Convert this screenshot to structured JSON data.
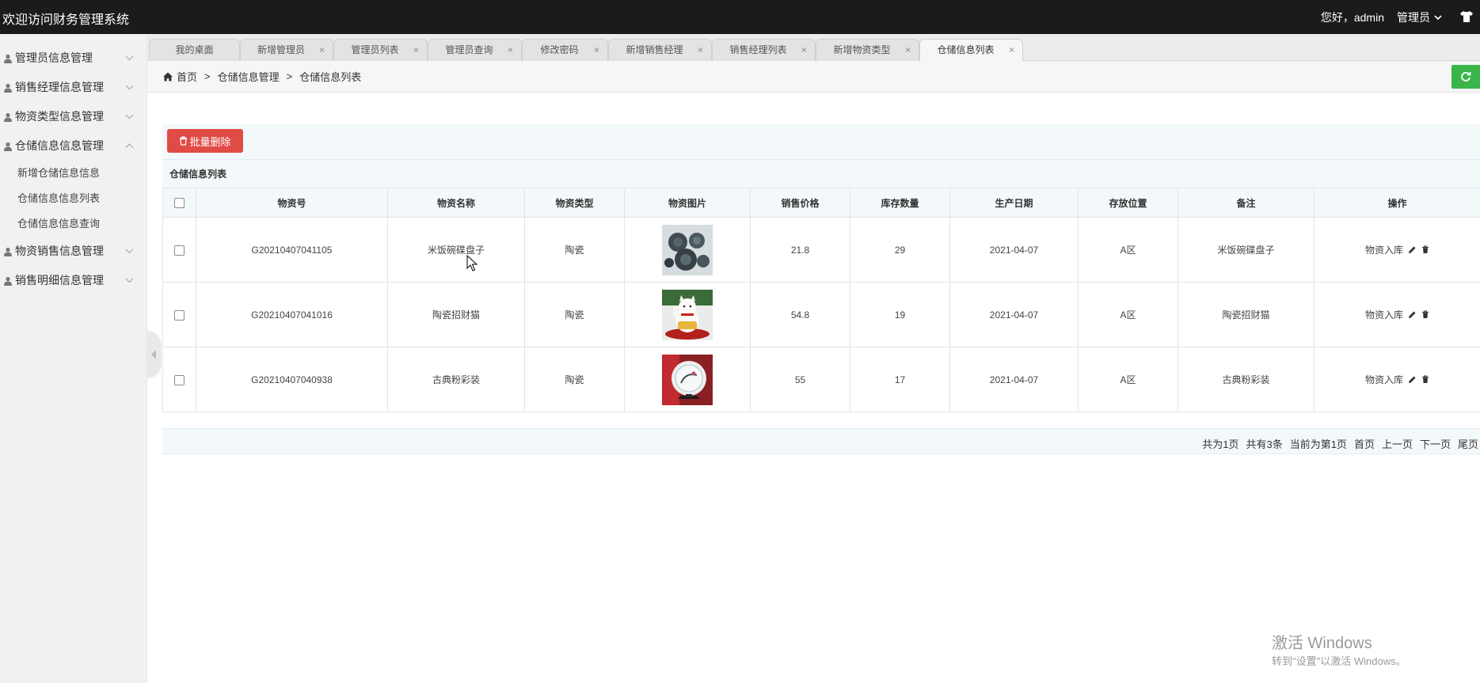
{
  "header": {
    "title": "欢迎访问财务管理系统",
    "greeting": "您好，admin",
    "role": "管理员"
  },
  "sidebar": {
    "items": [
      {
        "label": "管理员信息管理",
        "expanded": false
      },
      {
        "label": "销售经理信息管理",
        "expanded": false
      },
      {
        "label": "物资类型信息管理",
        "expanded": false
      },
      {
        "label": "仓储信息信息管理",
        "expanded": true,
        "children": [
          "新增仓储信息信息",
          "仓储信息信息列表",
          "仓储信息信息查询"
        ]
      },
      {
        "label": "物资销售信息管理",
        "expanded": false
      },
      {
        "label": "销售明细信息管理",
        "expanded": false
      }
    ]
  },
  "tabs": [
    {
      "label": "我的桌面",
      "closable": false
    },
    {
      "label": "新增管理员",
      "closable": true
    },
    {
      "label": "管理员列表",
      "closable": true
    },
    {
      "label": "管理员查询",
      "closable": true
    },
    {
      "label": "修改密码",
      "closable": true
    },
    {
      "label": "新增销售经理",
      "closable": true
    },
    {
      "label": "销售经理列表",
      "closable": true
    },
    {
      "label": "新增物资类型",
      "closable": true
    },
    {
      "label": "仓储信息列表",
      "closable": true,
      "active": true
    }
  ],
  "tab_close_glyph": "×",
  "breadcrumb": {
    "items": [
      "首页",
      "仓储信息管理",
      "仓储信息列表"
    ],
    "separator": ">"
  },
  "toolbar": {
    "batch_delete_label": "批量删除"
  },
  "list": {
    "title": "仓储信息列表",
    "columns": [
      "物资号",
      "物资名称",
      "物资类型",
      "物资图片",
      "销售价格",
      "库存数量",
      "生产日期",
      "存放位置",
      "备注",
      "操作"
    ],
    "rows": [
      {
        "code": "G20210407041105",
        "name": "米饭碗碟盘子",
        "type": "陶瓷",
        "image_icon": "dish-set-image",
        "price": "21.8",
        "stock": "29",
        "date": "2021-04-07",
        "location": "A区",
        "note": "米饭碗碟盘子",
        "action": "物资入库"
      },
      {
        "code": "G20210407041016",
        "name": "陶瓷招财猫",
        "type": "陶瓷",
        "image_icon": "lucky-cat-image",
        "price": "54.8",
        "stock": "19",
        "date": "2021-04-07",
        "location": "A区",
        "note": "陶瓷招财猫",
        "action": "物资入库"
      },
      {
        "code": "G20210407040938",
        "name": "古典粉彩装",
        "type": "陶瓷",
        "image_icon": "decorative-plate-image",
        "price": "55",
        "stock": "17",
        "date": "2021-04-07",
        "location": "A区",
        "note": "古典粉彩装",
        "action": "物资入库"
      }
    ]
  },
  "pager": {
    "total_pages": "共为1页",
    "total_items": "共有3条",
    "current": "当前为第1页",
    "first": "首页",
    "prev": "上一页",
    "next": "下一页",
    "last": "尾页"
  },
  "watermark": {
    "line1": "激活 Windows",
    "line2": "转到\"设置\"以激活 Windows。"
  },
  "colors": {
    "header_bg": "#1b1b1b",
    "danger": "#e14b46",
    "success": "#3bb54a",
    "panel_bg": "#f3f8fb"
  }
}
